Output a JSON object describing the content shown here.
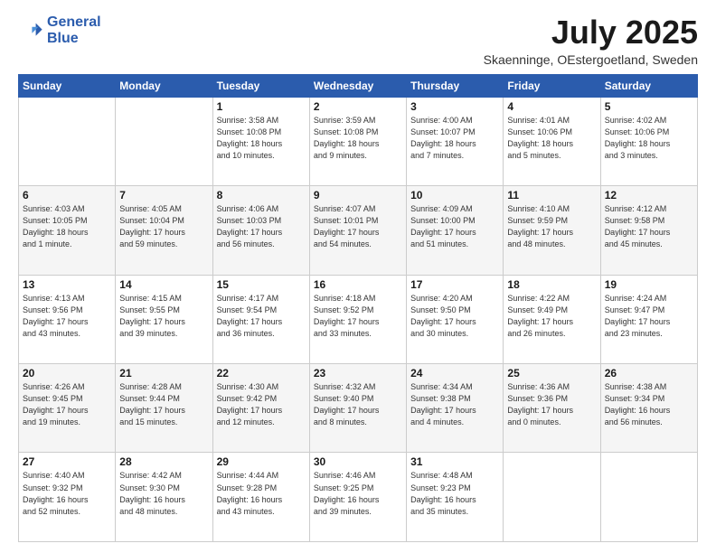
{
  "logo": {
    "line1": "General",
    "line2": "Blue"
  },
  "title": "July 2025",
  "location": "Skaenninge, OEstergoetland, Sweden",
  "days_of_week": [
    "Sunday",
    "Monday",
    "Tuesday",
    "Wednesday",
    "Thursday",
    "Friday",
    "Saturday"
  ],
  "weeks": [
    [
      {
        "day": "",
        "info": ""
      },
      {
        "day": "",
        "info": ""
      },
      {
        "day": "1",
        "info": "Sunrise: 3:58 AM\nSunset: 10:08 PM\nDaylight: 18 hours\nand 10 minutes."
      },
      {
        "day": "2",
        "info": "Sunrise: 3:59 AM\nSunset: 10:08 PM\nDaylight: 18 hours\nand 9 minutes."
      },
      {
        "day": "3",
        "info": "Sunrise: 4:00 AM\nSunset: 10:07 PM\nDaylight: 18 hours\nand 7 minutes."
      },
      {
        "day": "4",
        "info": "Sunrise: 4:01 AM\nSunset: 10:06 PM\nDaylight: 18 hours\nand 5 minutes."
      },
      {
        "day": "5",
        "info": "Sunrise: 4:02 AM\nSunset: 10:06 PM\nDaylight: 18 hours\nand 3 minutes."
      }
    ],
    [
      {
        "day": "6",
        "info": "Sunrise: 4:03 AM\nSunset: 10:05 PM\nDaylight: 18 hours\nand 1 minute."
      },
      {
        "day": "7",
        "info": "Sunrise: 4:05 AM\nSunset: 10:04 PM\nDaylight: 17 hours\nand 59 minutes."
      },
      {
        "day": "8",
        "info": "Sunrise: 4:06 AM\nSunset: 10:03 PM\nDaylight: 17 hours\nand 56 minutes."
      },
      {
        "day": "9",
        "info": "Sunrise: 4:07 AM\nSunset: 10:01 PM\nDaylight: 17 hours\nand 54 minutes."
      },
      {
        "day": "10",
        "info": "Sunrise: 4:09 AM\nSunset: 10:00 PM\nDaylight: 17 hours\nand 51 minutes."
      },
      {
        "day": "11",
        "info": "Sunrise: 4:10 AM\nSunset: 9:59 PM\nDaylight: 17 hours\nand 48 minutes."
      },
      {
        "day": "12",
        "info": "Sunrise: 4:12 AM\nSunset: 9:58 PM\nDaylight: 17 hours\nand 45 minutes."
      }
    ],
    [
      {
        "day": "13",
        "info": "Sunrise: 4:13 AM\nSunset: 9:56 PM\nDaylight: 17 hours\nand 43 minutes."
      },
      {
        "day": "14",
        "info": "Sunrise: 4:15 AM\nSunset: 9:55 PM\nDaylight: 17 hours\nand 39 minutes."
      },
      {
        "day": "15",
        "info": "Sunrise: 4:17 AM\nSunset: 9:54 PM\nDaylight: 17 hours\nand 36 minutes."
      },
      {
        "day": "16",
        "info": "Sunrise: 4:18 AM\nSunset: 9:52 PM\nDaylight: 17 hours\nand 33 minutes."
      },
      {
        "day": "17",
        "info": "Sunrise: 4:20 AM\nSunset: 9:50 PM\nDaylight: 17 hours\nand 30 minutes."
      },
      {
        "day": "18",
        "info": "Sunrise: 4:22 AM\nSunset: 9:49 PM\nDaylight: 17 hours\nand 26 minutes."
      },
      {
        "day": "19",
        "info": "Sunrise: 4:24 AM\nSunset: 9:47 PM\nDaylight: 17 hours\nand 23 minutes."
      }
    ],
    [
      {
        "day": "20",
        "info": "Sunrise: 4:26 AM\nSunset: 9:45 PM\nDaylight: 17 hours\nand 19 minutes."
      },
      {
        "day": "21",
        "info": "Sunrise: 4:28 AM\nSunset: 9:44 PM\nDaylight: 17 hours\nand 15 minutes."
      },
      {
        "day": "22",
        "info": "Sunrise: 4:30 AM\nSunset: 9:42 PM\nDaylight: 17 hours\nand 12 minutes."
      },
      {
        "day": "23",
        "info": "Sunrise: 4:32 AM\nSunset: 9:40 PM\nDaylight: 17 hours\nand 8 minutes."
      },
      {
        "day": "24",
        "info": "Sunrise: 4:34 AM\nSunset: 9:38 PM\nDaylight: 17 hours\nand 4 minutes."
      },
      {
        "day": "25",
        "info": "Sunrise: 4:36 AM\nSunset: 9:36 PM\nDaylight: 17 hours\nand 0 minutes."
      },
      {
        "day": "26",
        "info": "Sunrise: 4:38 AM\nSunset: 9:34 PM\nDaylight: 16 hours\nand 56 minutes."
      }
    ],
    [
      {
        "day": "27",
        "info": "Sunrise: 4:40 AM\nSunset: 9:32 PM\nDaylight: 16 hours\nand 52 minutes."
      },
      {
        "day": "28",
        "info": "Sunrise: 4:42 AM\nSunset: 9:30 PM\nDaylight: 16 hours\nand 48 minutes."
      },
      {
        "day": "29",
        "info": "Sunrise: 4:44 AM\nSunset: 9:28 PM\nDaylight: 16 hours\nand 43 minutes."
      },
      {
        "day": "30",
        "info": "Sunrise: 4:46 AM\nSunset: 9:25 PM\nDaylight: 16 hours\nand 39 minutes."
      },
      {
        "day": "31",
        "info": "Sunrise: 4:48 AM\nSunset: 9:23 PM\nDaylight: 16 hours\nand 35 minutes."
      },
      {
        "day": "",
        "info": ""
      },
      {
        "day": "",
        "info": ""
      }
    ]
  ]
}
